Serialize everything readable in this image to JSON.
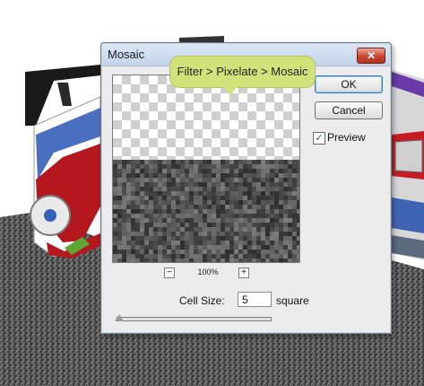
{
  "dialog": {
    "title": "Mosaic",
    "close_label": "✕",
    "zoom_out_label": "−",
    "zoom_in_label": "+",
    "zoom_level": "100%",
    "ok_label": "OK",
    "cancel_label": "Cancel",
    "preview_checkbox_mark": "✓",
    "preview_checked": true,
    "preview_label": "Preview",
    "cell_size_label": "Cell Size:",
    "cell_size_value": "5",
    "cell_size_unit": "square",
    "cell_size_slider_fraction": 0.0
  },
  "tooltip": {
    "text": "Filter > Pixelate > Mosaic"
  },
  "colors": {
    "tooltip_bg": "#d2e27b",
    "close_button": "#c8452e",
    "ok_focus": "#3c7fb1",
    "car_red": "#b5171f",
    "car_blue": "#3f63b3",
    "car_purple": "#6a3aa8"
  }
}
